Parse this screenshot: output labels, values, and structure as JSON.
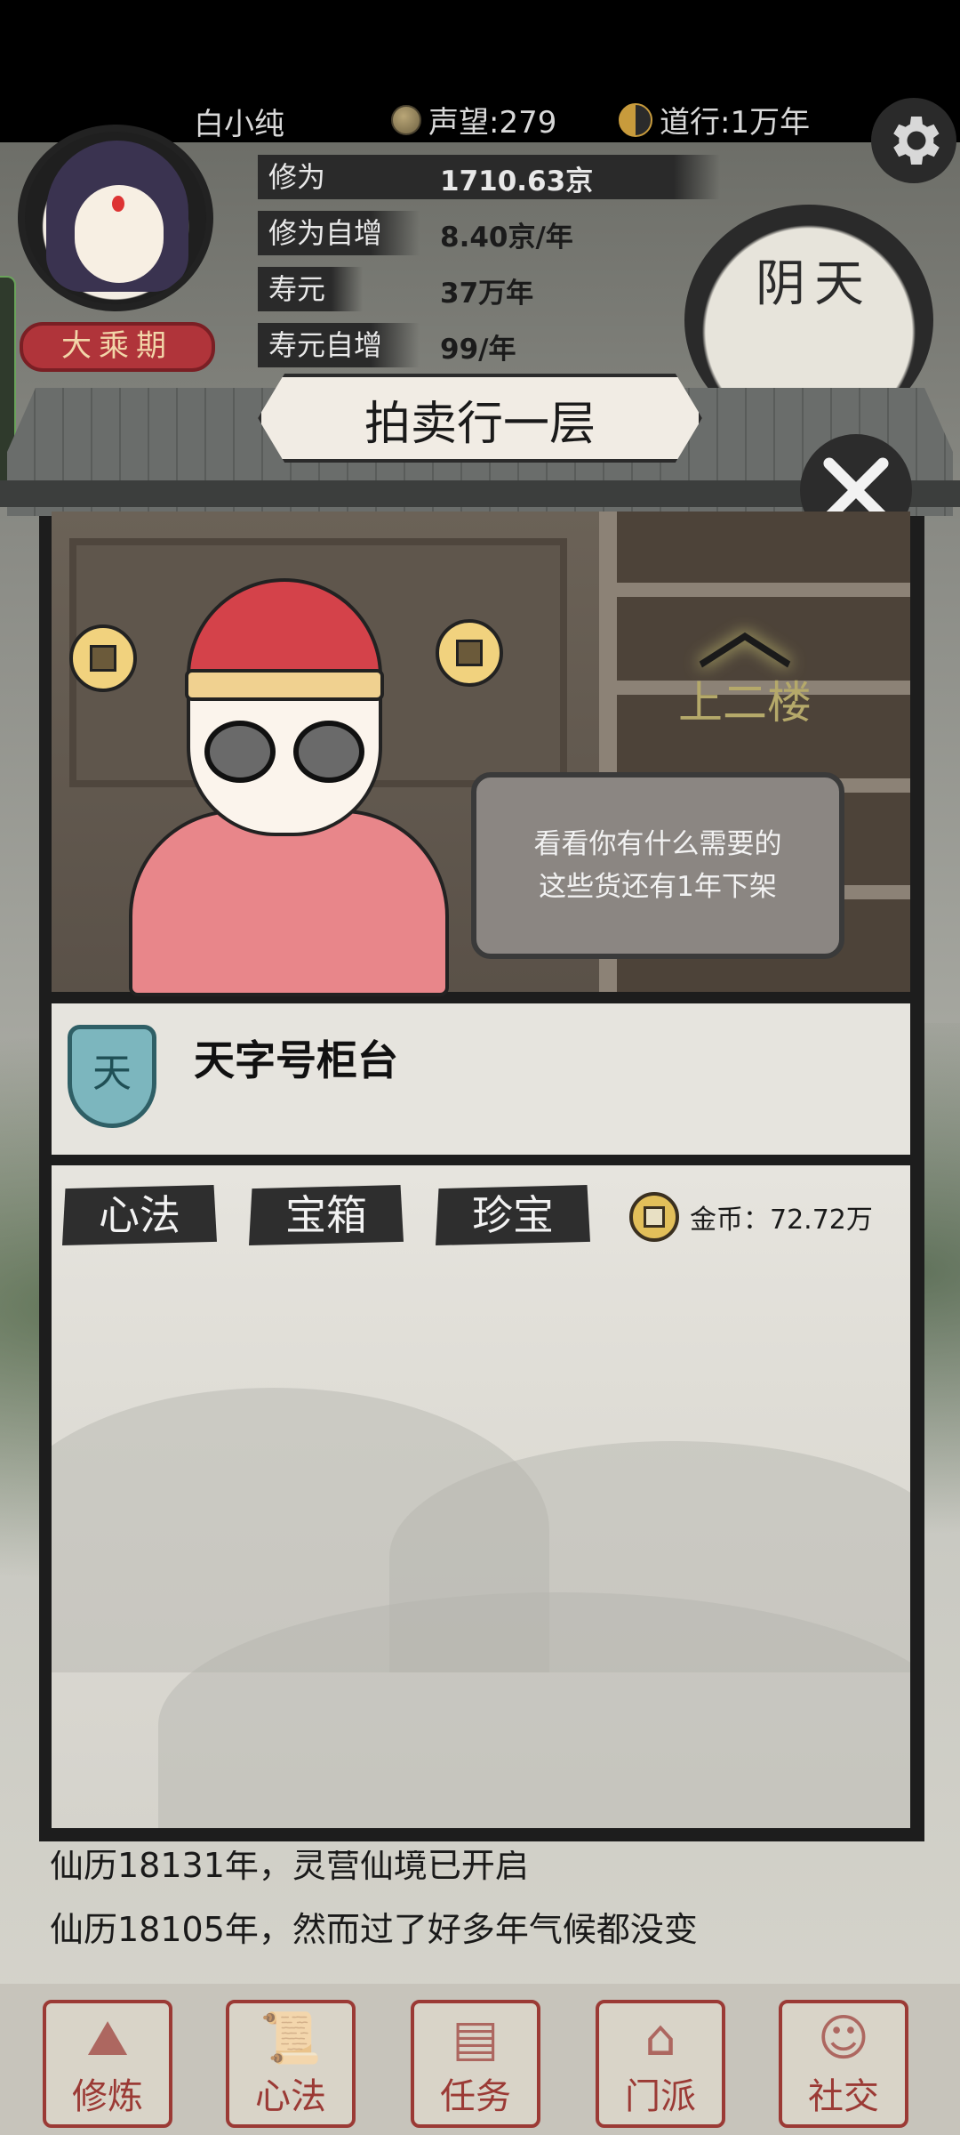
{
  "player": {
    "name": "白小纯",
    "reputation": "声望:279",
    "dao_years": "道行:1万年",
    "realm": "大乘期"
  },
  "stats": [
    {
      "label": "修为",
      "value": "1710.63京"
    },
    {
      "label": "修为自增",
      "value": "8.40京/年"
    },
    {
      "label": "寿元",
      "value": "37万年"
    },
    {
      "label": "寿元自增",
      "value": "99/年"
    }
  ],
  "weather": "阴天",
  "auction": {
    "title": "拍卖行一层",
    "upstairs_label": "上二楼",
    "npc_speech_line1": "看看你有什么需要的",
    "npc_speech_line2": "这些货还有1年下架",
    "counter_badge": "天",
    "counter_title": "天字号柜台",
    "tabs": [
      "心法",
      "宝箱",
      "珍宝"
    ],
    "gold": "金币：72.72万"
  },
  "log": [
    "仙历18131年，灵营仙境已开启",
    "仙历18105年，然而过了好多年气候都没变"
  ],
  "bottom_nav": [
    {
      "label": "修炼",
      "icon": "cultivate-icon"
    },
    {
      "label": "心法",
      "icon": "scroll-icon"
    },
    {
      "label": "任务",
      "icon": "task-icon"
    },
    {
      "label": "门派",
      "icon": "sect-icon"
    },
    {
      "label": "社交",
      "icon": "social-icon"
    }
  ],
  "colors": {
    "accent_red": "#9b3a35",
    "panel_dark": "#1d1d1d",
    "gold": "#e2bf5a"
  }
}
